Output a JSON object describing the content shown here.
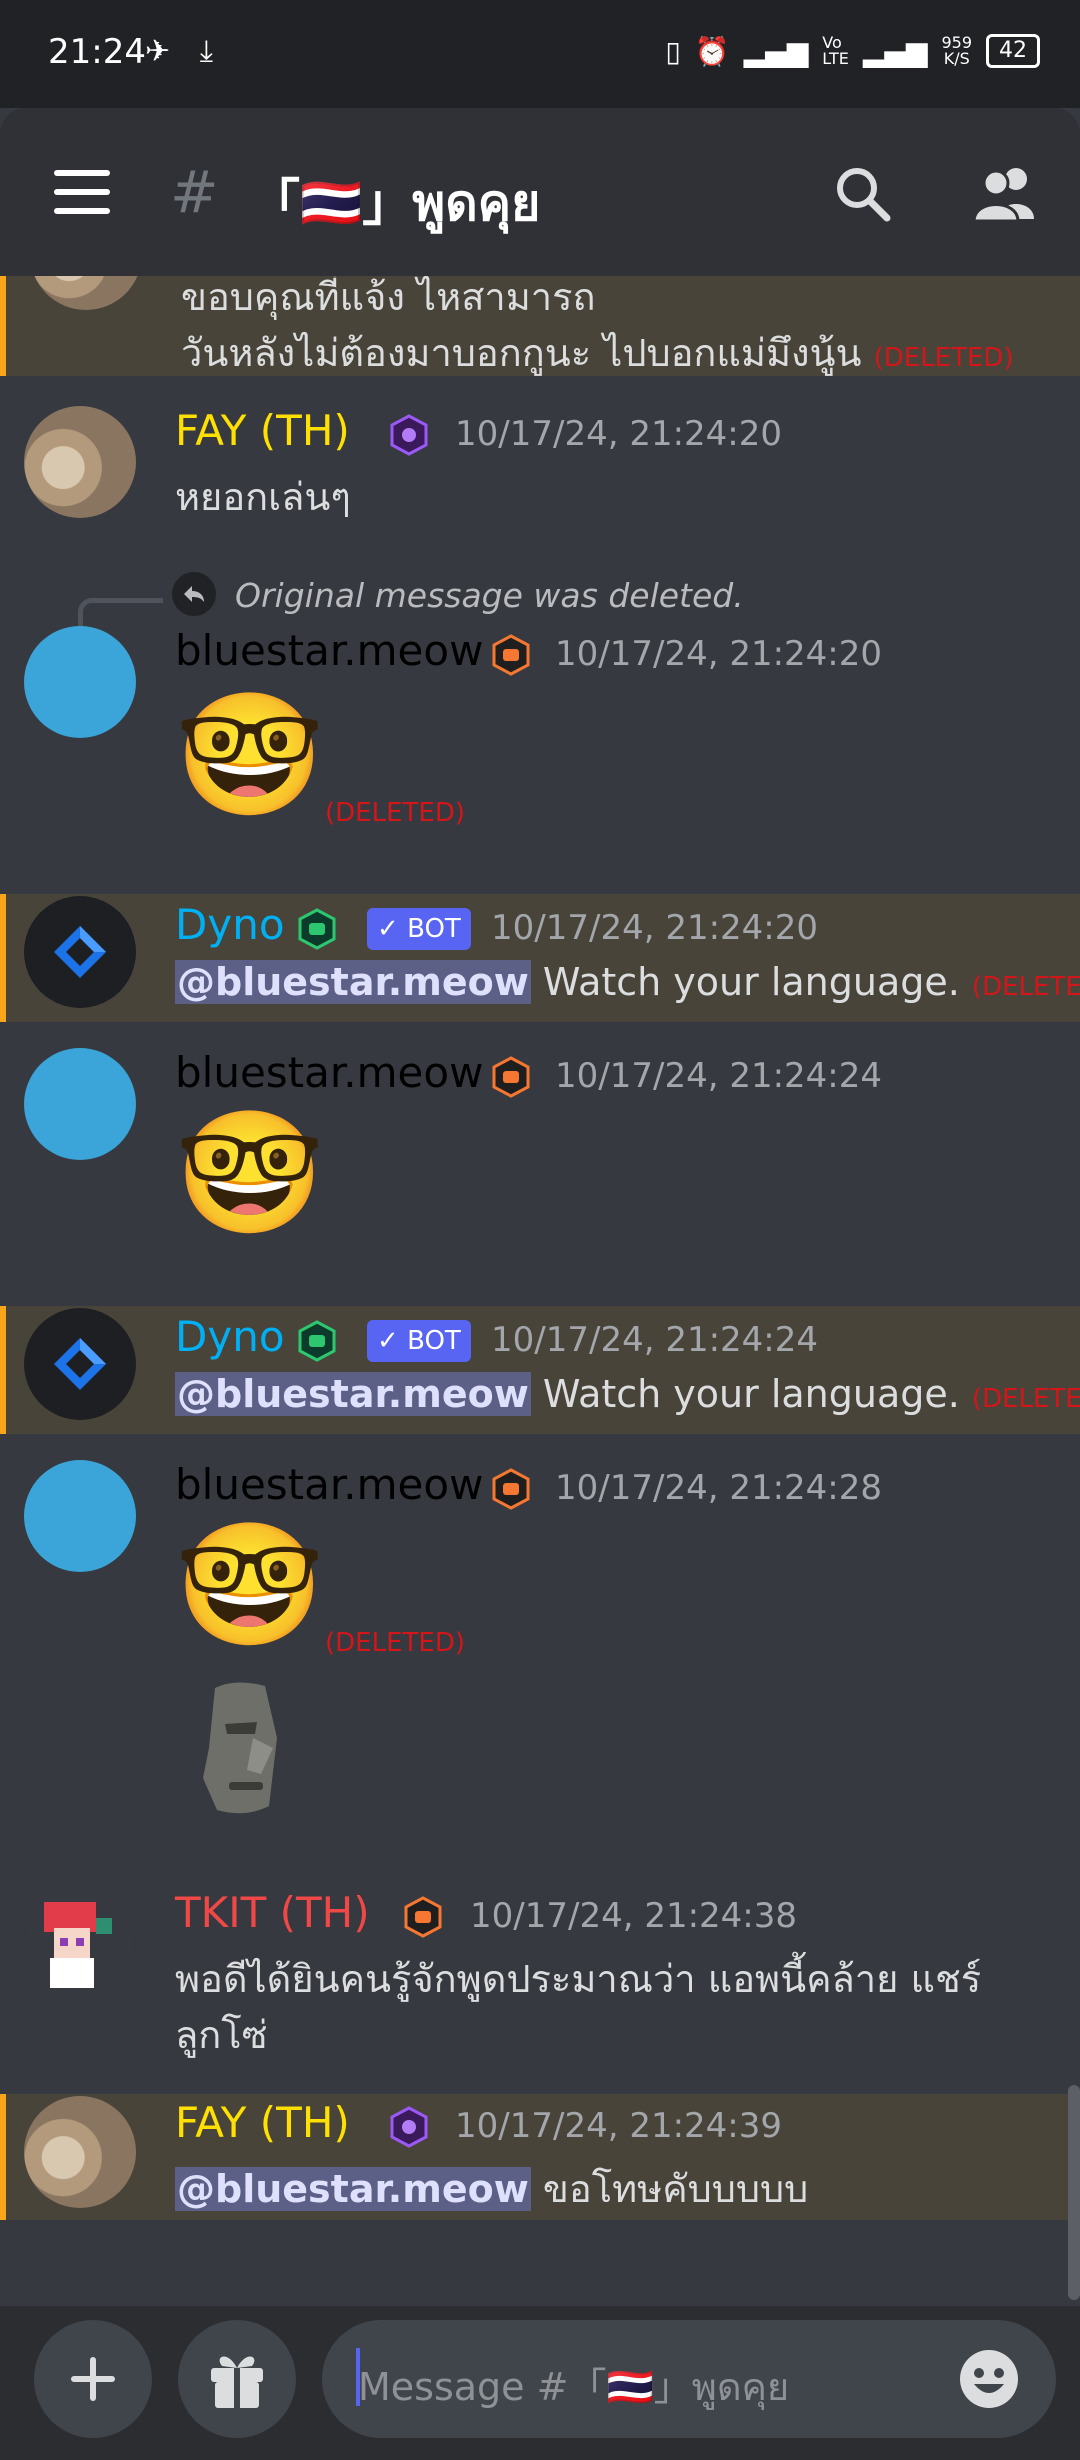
{
  "status_bar": {
    "time": "21:24",
    "network_speed": "959",
    "network_unit": "K/S",
    "battery": "42"
  },
  "channel": {
    "hash": "#",
    "name": "「🇹🇭」พูดคุย"
  },
  "messages": [
    {
      "lines": [
        "ขอบคุณที่แจ้ง ไหสามารถ",
        "วันหลังไม่ต้องมาบอกกูนะ ไปบอกแม่มึงนู้น"
      ],
      "deleted": "(DELETED)"
    },
    {
      "author": "FAY (TH)",
      "author_color": "#ffe000",
      "timestamp": "10/17/24, 21:24:20",
      "text": "หยอกเล่นๆ"
    },
    {
      "reply": "Original message was deleted.",
      "author": "bluestar.meow",
      "author_color": "#000000",
      "timestamp": "10/17/24, 21:24:20",
      "emoji": "🤓",
      "deleted": "(DELETED)"
    },
    {
      "author": "Dyno",
      "author_color": "#00b0f4",
      "bot_label": "BOT",
      "timestamp": "10/17/24, 21:24:20",
      "mention": "@bluestar.meow",
      "text": "Watch your language.",
      "deleted": "(DELETED)"
    },
    {
      "author": "bluestar.meow",
      "author_color": "#000000",
      "timestamp": "10/17/24, 21:24:24",
      "emoji": "🤓"
    },
    {
      "author": "Dyno",
      "author_color": "#00b0f4",
      "bot_label": "BOT",
      "timestamp": "10/17/24, 21:24:24",
      "mention": "@bluestar.meow",
      "text": "Watch your language.",
      "deleted": "(DELETED)"
    },
    {
      "author": "bluestar.meow",
      "author_color": "#000000",
      "timestamp": "10/17/24, 21:24:28",
      "emoji": "🤓",
      "deleted": "(DELETED)",
      "sticker": "moai-sticker"
    },
    {
      "author": "TKIT (TH)",
      "author_color": "#f04747",
      "timestamp": "10/17/24, 21:24:38",
      "lines": [
        "พอดีได้ยินคนรู้จักพูดประมาณว่า แอพนี้คล้าย แชร์",
        "ลูกโซ่"
      ]
    },
    {
      "author": "FAY (TH)",
      "author_color": "#ffe000",
      "timestamp": "10/17/24, 21:24:39",
      "mention": "@bluestar.meow",
      "text": "ขอโทษคับบบบบ"
    }
  ],
  "composer": {
    "placeholder": "Message #「🇹🇭」พูดคุย"
  },
  "colors": {
    "background": "#36393f",
    "header": "#2f3136",
    "highlight": "#48443a",
    "highlight_border": "#faa61a",
    "deleted": "#d2161a",
    "mention_bg": "#5c5f86",
    "bot_badge": "#5865f2"
  }
}
